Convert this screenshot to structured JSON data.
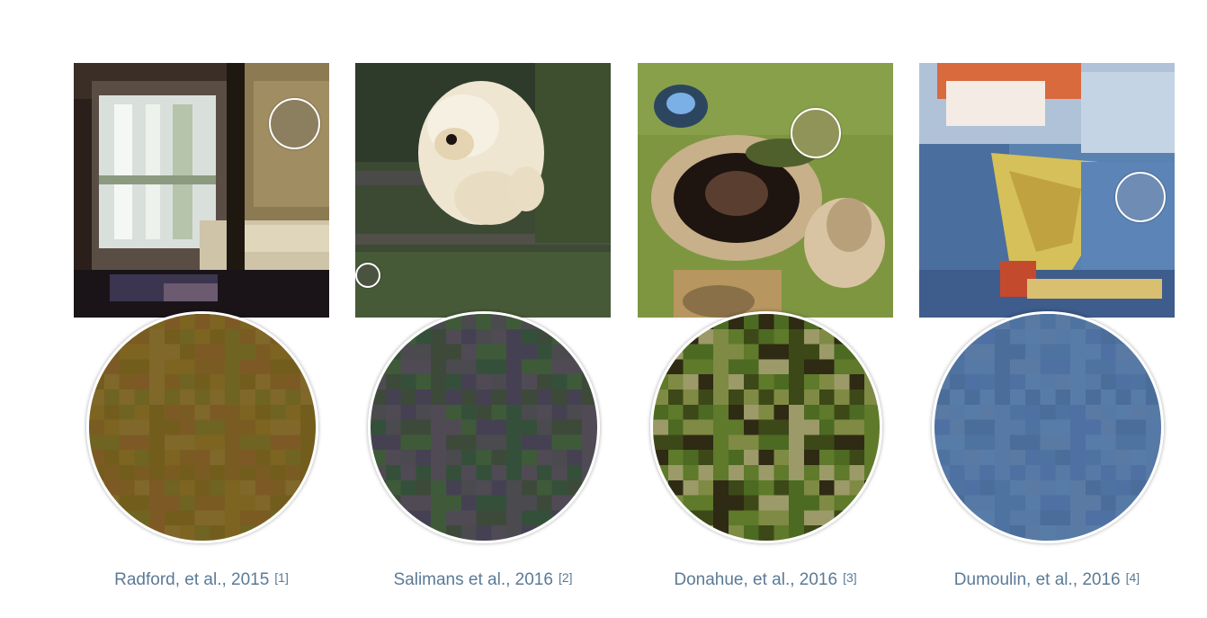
{
  "figures": [
    {
      "caption": "Radford, et al., 2015",
      "ref": "[1]",
      "zoom_colors": [
        "#7d6421",
        "#7a5c22",
        "#6f6422",
        "#7d5a25",
        "#735d1d",
        "#80682a"
      ]
    },
    {
      "caption": "Salimans et al., 2016",
      "ref": "[2]",
      "zoom_colors": [
        "#3d4a3a",
        "#4a4a4f",
        "#35503a",
        "#454152",
        "#3f5a38",
        "#504a55"
      ]
    },
    {
      "caption": "Donahue, et al., 2016",
      "ref": "[3]",
      "zoom_colors": [
        "#5e7a2a",
        "#7f8a44",
        "#4c6a22",
        "#9b9a68",
        "#3d4818",
        "#2e2a14"
      ]
    },
    {
      "caption": "Dumoulin, et al., 2016",
      "ref": "[4]",
      "zoom_colors": [
        "#4e73a0",
        "#5679a6",
        "#4b6d9a",
        "#5a7aa4",
        "#4f70a3",
        "#587ca8"
      ]
    }
  ]
}
